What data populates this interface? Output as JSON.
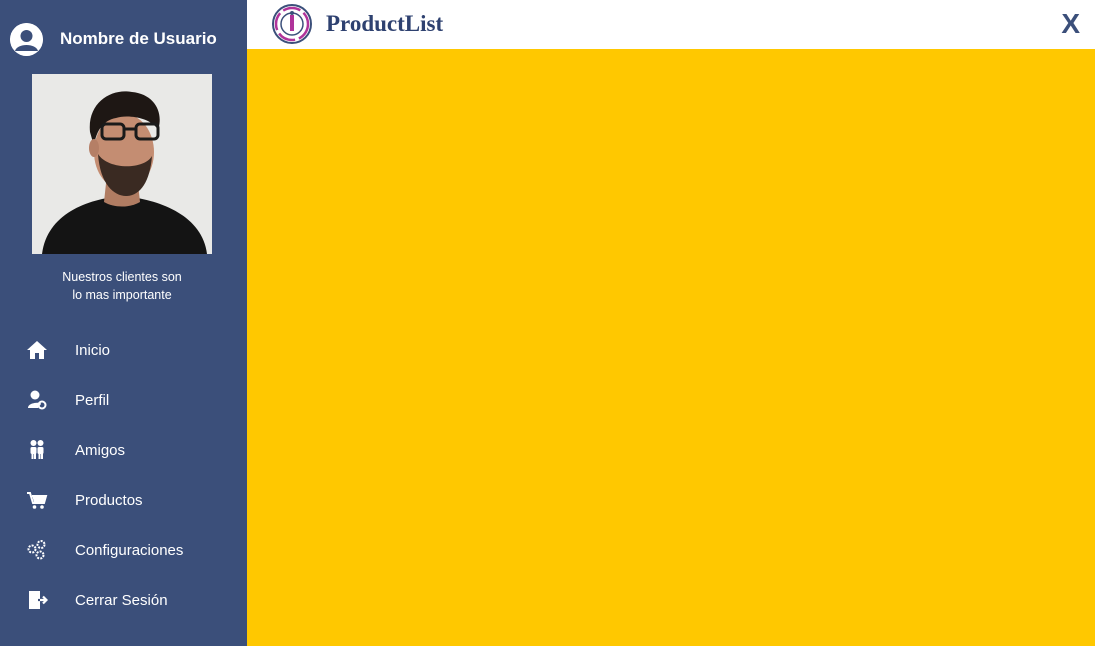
{
  "sidebar": {
    "user_name": "Nombre de Usuario",
    "tagline_line1": "Nuestros clientes son",
    "tagline_line2": "lo mas importante",
    "items": [
      {
        "label": "Inicio",
        "icon": "home-icon"
      },
      {
        "label": "Perfil",
        "icon": "user-settings-icon"
      },
      {
        "label": "Amigos",
        "icon": "friends-icon"
      },
      {
        "label": "Productos",
        "icon": "cart-icon"
      },
      {
        "label": "Configuraciones",
        "icon": "gears-icon"
      },
      {
        "label": "Cerrar Sesión",
        "icon": "logout-icon"
      }
    ]
  },
  "header": {
    "title": "ProductList",
    "close_label": "X"
  },
  "colors": {
    "sidebar_bg": "#3b4f7a",
    "content_bg": "#ffc800",
    "title_color": "#2e4170",
    "logo_accent": "#b0339a"
  }
}
